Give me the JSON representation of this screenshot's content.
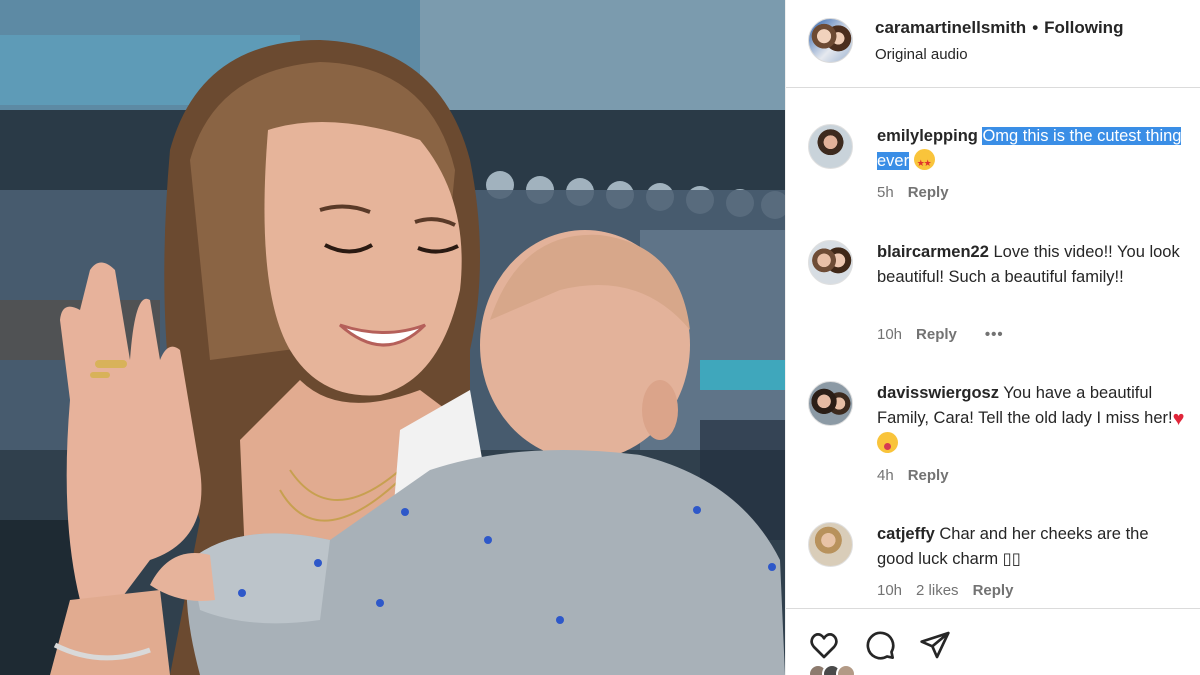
{
  "post": {
    "username": "caramartinellsmith",
    "separator": "•",
    "follow_status": "Following",
    "audio": "Original audio",
    "avatar_icon": "profile-photo-icon"
  },
  "comments": [
    {
      "user": "emilylepping",
      "text_plain": "",
      "text_highlighted": "Omg this is the cutest thing ever",
      "emoji": "star-struck-emoji",
      "time": "5h",
      "likes": "",
      "reply": "Reply",
      "more": ""
    },
    {
      "user": "blaircarmen22",
      "text_plain": "Love this video!! You look beautiful! Such a beautiful family!!",
      "text_highlighted": "",
      "emoji": "",
      "time": "10h",
      "likes": "",
      "reply": "Reply",
      "more": "•••"
    },
    {
      "user": "davisswiergosz",
      "text_plain": "You have a beautiful Family, Cara! Tell the old lady I miss her!",
      "text_highlighted": "",
      "emoji": "heart-and-tongue-emoji",
      "time": "4h",
      "likes": "",
      "reply": "Reply",
      "more": ""
    },
    {
      "user": "catjeffy",
      "text_plain": "Char and her cheeks are the good luck charm ▯▯",
      "text_highlighted": "",
      "emoji": "",
      "time": "10h",
      "likes": "2 likes",
      "reply": "Reply",
      "more": ""
    }
  ],
  "actions": {
    "like_icon": "heart-icon",
    "comment_icon": "comment-bubble-icon",
    "share_icon": "paper-plane-icon"
  },
  "colors": {
    "text": "#262626",
    "secondary": "#737373",
    "highlight": "#3a8ee6",
    "divider": "#dbdbdb"
  }
}
